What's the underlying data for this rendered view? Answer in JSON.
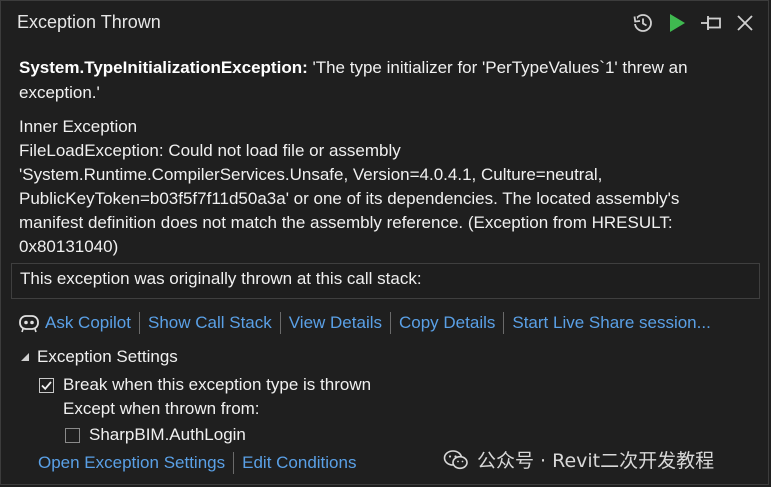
{
  "window": {
    "title": "Exception Thrown",
    "icons": [
      "history-icon",
      "continue-play-icon",
      "pin-icon",
      "close-icon"
    ]
  },
  "exception": {
    "type": "System.TypeInitializationException:",
    "message": " 'The type initializer for 'PerTypeValues`1' threw an exception.'"
  },
  "inner": {
    "heading": "Inner Exception",
    "lines": [
      "FileLoadException: Could not load file or assembly",
      "'System.Runtime.CompilerServices.Unsafe, Version=4.0.4.1, Culture=neutral,",
      "PublicKeyToken=b03f5f7f11d50a3a' or one of its dependencies. The located assembly's",
      "manifest definition does not match the assembly reference. (Exception from HRESULT:",
      "0x80131040)"
    ]
  },
  "callstack": {
    "text": "This exception was originally thrown at this call stack:"
  },
  "actions": {
    "ask_copilot": "Ask Copilot",
    "show_call_stack": "Show Call Stack",
    "view_details": "View Details",
    "copy_details": "Copy Details",
    "live_share": "Start Live Share session..."
  },
  "settings": {
    "heading": "Exception Settings",
    "break_label": "Break when this exception type is thrown",
    "break_checked": true,
    "except_label": "Except when thrown from:",
    "module_label": "SharpBIM.AuthLogin",
    "module_checked": false
  },
  "bottom": {
    "open_settings": "Open Exception Settings",
    "edit_conditions": "Edit Conditions"
  },
  "watermark": {
    "text": "公众号 · Revit二次开发教程"
  },
  "colors": {
    "background": "#1f1f1f",
    "link": "#5aa0e6",
    "play_green": "#3fb950",
    "text": "#f0f0f0"
  }
}
